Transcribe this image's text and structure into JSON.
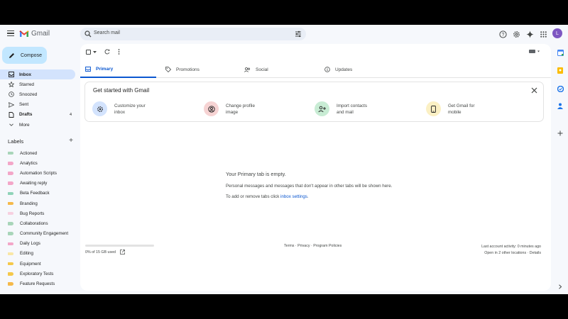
{
  "app": {
    "name": "Gmail",
    "avatar_letter": "L"
  },
  "search": {
    "placeholder": "Search mail"
  },
  "compose": {
    "label": "Compose"
  },
  "nav": [
    {
      "label": "Inbox",
      "icon": "inbox-icon",
      "active": true
    },
    {
      "label": "Starred",
      "icon": "star-icon"
    },
    {
      "label": "Snoozed",
      "icon": "clock-icon"
    },
    {
      "label": "Sent",
      "icon": "send-icon"
    },
    {
      "label": "Drafts",
      "icon": "draft-icon",
      "count": "4",
      "bold": true
    },
    {
      "label": "More",
      "icon": "chevron-down-icon"
    }
  ],
  "labels": {
    "title": "Labels",
    "items": [
      {
        "label": "Actioned",
        "color": "#a8d5b9"
      },
      {
        "label": "Analytics",
        "color": "#f3a6c8"
      },
      {
        "label": "Automation Scripts",
        "color": "#f3a6c8"
      },
      {
        "label": "Awaiting reply",
        "color": "#f3a6c8"
      },
      {
        "label": "Beta Feedback",
        "color": "#8fd3b8"
      },
      {
        "label": "Branding",
        "color": "#f5b94a"
      },
      {
        "label": "Bug Reports",
        "color": "#f7d0e0"
      },
      {
        "label": "Collaborations",
        "color": "#a8d5b9"
      },
      {
        "label": "Community Engagement",
        "color": "#a8d5b9"
      },
      {
        "label": "Daily Logs",
        "color": "#f3a6c8"
      },
      {
        "label": "Editing",
        "color": "#f9e7a6"
      },
      {
        "label": "Equipment",
        "color": "#f5c84a"
      },
      {
        "label": "Exploratory Tests",
        "color": "#f5c84a"
      },
      {
        "label": "Feature Requests",
        "color": "#f5b94a"
      }
    ]
  },
  "tabs": [
    {
      "label": "Primary",
      "icon": "inbox-icon",
      "active": true
    },
    {
      "label": "Promotions",
      "icon": "tag-icon"
    },
    {
      "label": "Social",
      "icon": "people-icon"
    },
    {
      "label": "Updates",
      "icon": "info-icon"
    }
  ],
  "get_started": {
    "title": "Get started with Gmail",
    "items": [
      {
        "line1": "Customize your",
        "line2": "inbox",
        "icon": "gear-icon",
        "bg": "#d3e3fd"
      },
      {
        "line1": "Change profile",
        "line2": "image",
        "icon": "account-icon",
        "bg": "#f6d3d3"
      },
      {
        "line1": "Import contacts",
        "line2": "and mail",
        "icon": "person-add-icon",
        "bg": "#c8ecd4"
      },
      {
        "line1": "Get Gmail for",
        "line2": "mobile",
        "icon": "phone-icon",
        "bg": "#fbf0c4"
      }
    ]
  },
  "empty": {
    "title": "Your Primary tab is empty.",
    "line1": "Personal messages and messages that don't appear in other tabs will be shown here.",
    "line2_prefix": "To add or remove tabs click ",
    "line2_link": "inbox settings",
    "line2_suffix": "."
  },
  "footer": {
    "storage": "0% of 15 GB used",
    "storage_fraction": 0,
    "links": "Terms · Privacy · Program Policies",
    "activity": "Last account activity: 0 minutes ago",
    "locations": "Open in 2 other locations · Details"
  }
}
